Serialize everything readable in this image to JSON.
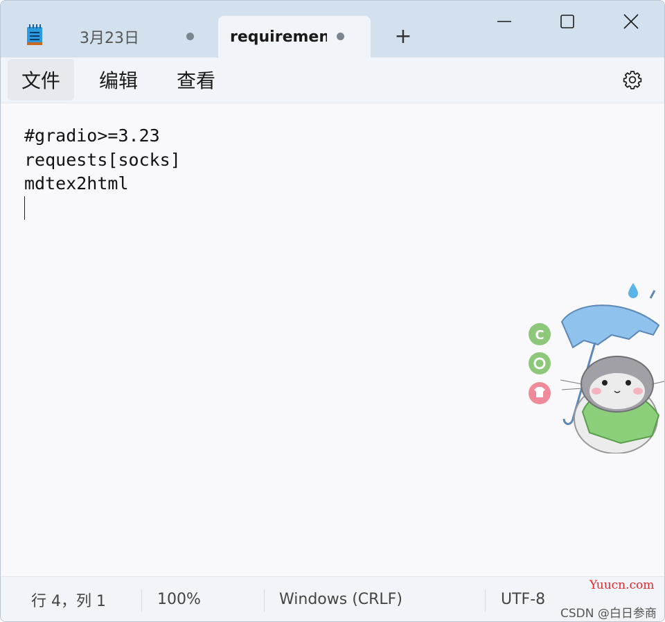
{
  "titlebar": {
    "app_icon": "notepad-icon",
    "tabs": [
      {
        "label": "3月23日",
        "unsaved_dot": true,
        "active": false
      },
      {
        "label": "requiremen",
        "unsaved_dot": true,
        "active": true
      }
    ],
    "new_tab_glyph": "+",
    "window_controls": [
      "minimize-icon",
      "maximize-icon",
      "close-icon"
    ]
  },
  "menu": {
    "items": [
      {
        "label": "文件"
      },
      {
        "label": "编辑"
      },
      {
        "label": "查看"
      }
    ],
    "settings_icon": "gear-icon"
  },
  "editor": {
    "lines": [
      "#gradio>=3.23",
      "requests[socks]",
      "mdtex2html",
      ""
    ],
    "decoration": "hamster-with-umbrella-sticker"
  },
  "status": {
    "position": "行 4，列 1",
    "zoom": "100%",
    "line_ending": "Windows (CRLF)",
    "encoding": "UTF-8"
  },
  "watermark": {
    "line1": "Yuucn.com",
    "line2": "CSDN @白日参商"
  },
  "colors": {
    "titlebar_bg": "#d3e1ee",
    "menubar_bg": "#f1f4f8",
    "editor_bg": "#f9f9fb",
    "watermark_red": "#e0292c"
  }
}
